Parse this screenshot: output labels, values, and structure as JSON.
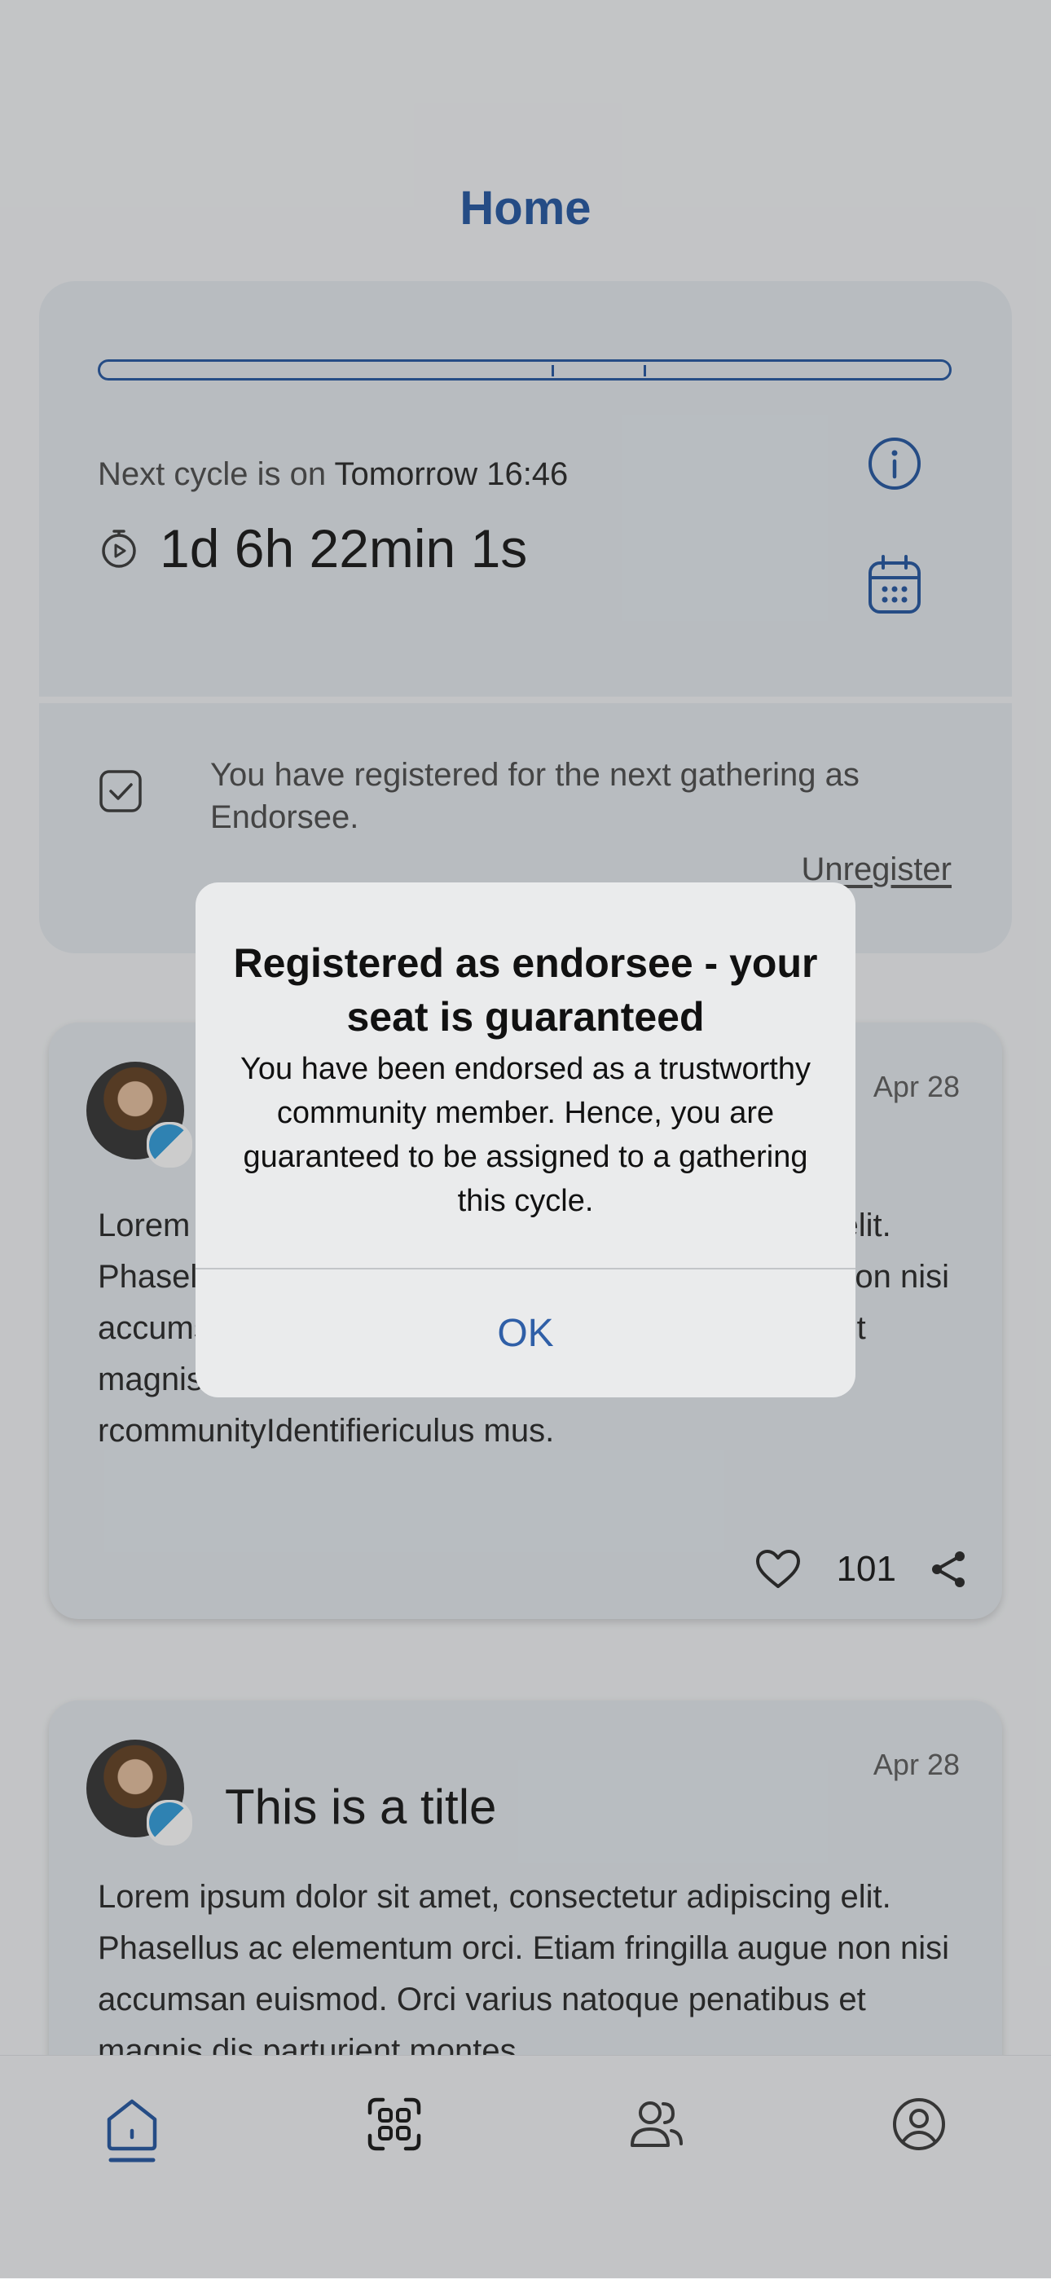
{
  "header": {
    "title": "Home"
  },
  "cycle": {
    "progress_marks": [
      0.532,
      0.64
    ],
    "next_cycle_prefix": "Next cycle is on ",
    "next_cycle_value": "Tomorrow 16:46",
    "countdown": "1d 6h 22min 1s",
    "registration_text": "You have registered for the next gathering as Endorsee.",
    "unregister_label": "Unregister"
  },
  "posts": [
    {
      "date": "Apr 28",
      "title": "",
      "body": "Lorem ipsum dolor sit amet, consectetur adipiscing elit. Phasellus ac elementum orci. Etiam fringilla augue non nisi accumsan euismod. Orci varius natoque penatibus et magnis dis parturient montes, nascetur rcommunityIdentifiericulus mus.",
      "likes": "101"
    },
    {
      "date": "Apr 28",
      "title": "This is a title",
      "body": "Lorem ipsum dolor sit amet, consectetur adipiscing elit. Phasellus ac elementum orci. Etiam fringilla augue non nisi accumsan euismod. Orci varius natoque penatibus et magnis dis parturient montes,"
    }
  ],
  "nav": {
    "items": [
      {
        "icon": "home-icon",
        "active": true
      },
      {
        "icon": "qr-scan-icon",
        "active": false
      },
      {
        "icon": "people-icon",
        "active": false
      },
      {
        "icon": "profile-icon",
        "active": false
      }
    ]
  },
  "dialog": {
    "title": "Registered as endorsee - your seat is guaranteed",
    "message": "You have been endorsed as a trustworthy community member. Hence, you are guaranteed to be assigned to a gathering this cycle.",
    "ok_label": "OK"
  },
  "colors": {
    "accent": "#2f5fa7",
    "card": "#e6ecf1",
    "background": "#f4f6f8"
  }
}
